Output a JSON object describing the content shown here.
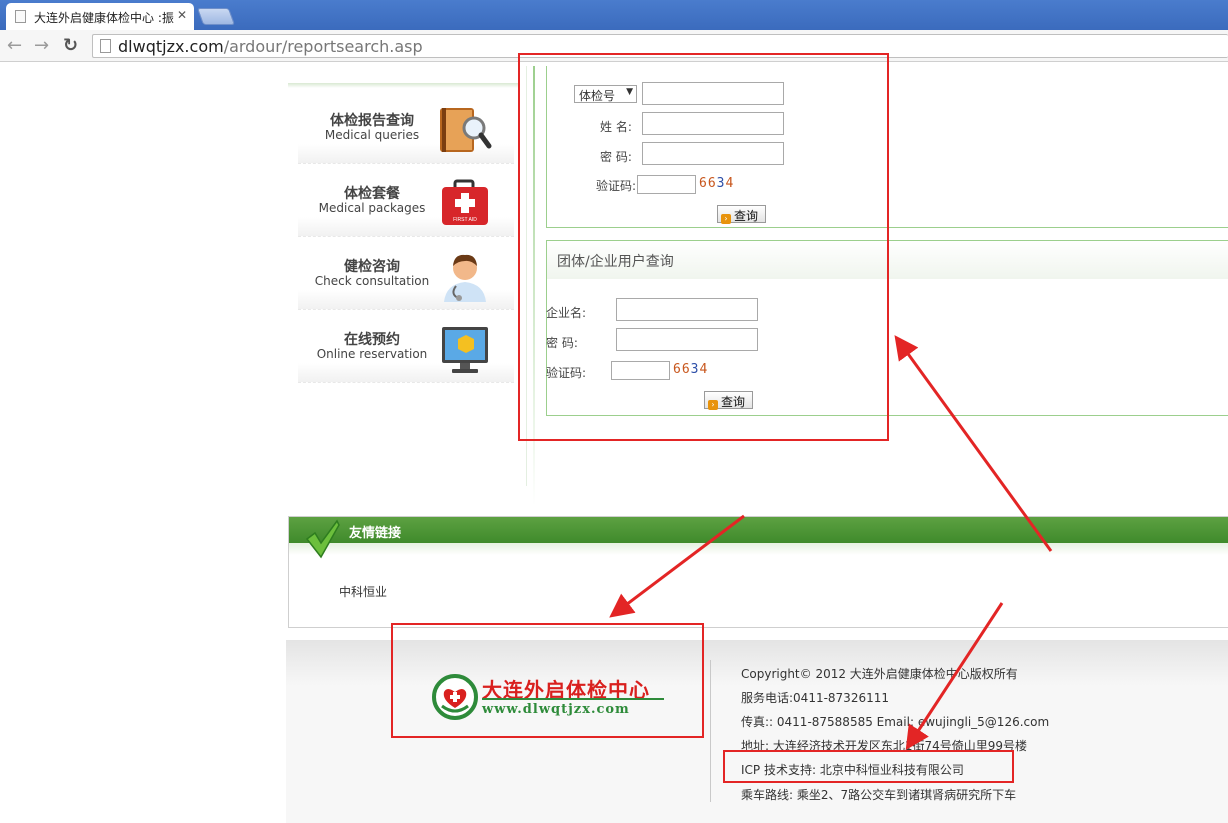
{
  "browser": {
    "tab_title": "大连外启健康体检中心 :振",
    "close_glyph": "✕",
    "url_host": "dlwqtjzx.com",
    "url_path": "/ardour/reportsearch.asp"
  },
  "sidebar": {
    "items": [
      {
        "zh": "体检报告查询",
        "en": "Medical queries",
        "icon": "book-magnifier-icon"
      },
      {
        "zh": "体检套餐",
        "en": "Medical packages",
        "icon": "first-aid-kit-icon"
      },
      {
        "zh": "健检咨询",
        "en": "Check consultation",
        "icon": "doctor-icon"
      },
      {
        "zh": "在线预约",
        "en": "Online reservation",
        "icon": "monitor-icon"
      }
    ],
    "kit_label": "FIRST AID"
  },
  "personal_query": {
    "select_value": "体检号",
    "name_label": "姓  名:",
    "password_label": "密  码:",
    "captcha_label": "验证码:",
    "captcha": [
      "6",
      "6",
      "3",
      "4"
    ],
    "button": "查询"
  },
  "group_query": {
    "title": "团体/企业用户查询",
    "company_label": "企业名:",
    "password_label": "密  码:",
    "captcha_label": "验证码:",
    "captcha": [
      "6",
      "6",
      "3",
      "4"
    ],
    "button": "查询"
  },
  "links": {
    "title": "友情链接",
    "items": [
      "中科恒业"
    ]
  },
  "footer": {
    "logo_zh": "大连外启体检中心",
    "logo_en": "www.dlwqtjzx.com",
    "lines": [
      "Copyright© 2012 大连外启健康体检中心版权所有",
      "服务电话:0411-87326111",
      "传真::  0411-87588585    Email:  ewujingli_5@126.com",
      "地址: 大连经济技术开发区东北1街74号倚山里99号楼",
      "ICP 技术支持: 北京中科恒业科技有限公司",
      "乘车路线:  乘坐2、7路公交车到诸琪肾病研究所下车"
    ]
  },
  "colors": {
    "accent_green": "#3f8a2b",
    "annotation_red": "#e32525",
    "captcha_orange": "#c8561c",
    "captcha_blue": "#2d4fa8"
  }
}
